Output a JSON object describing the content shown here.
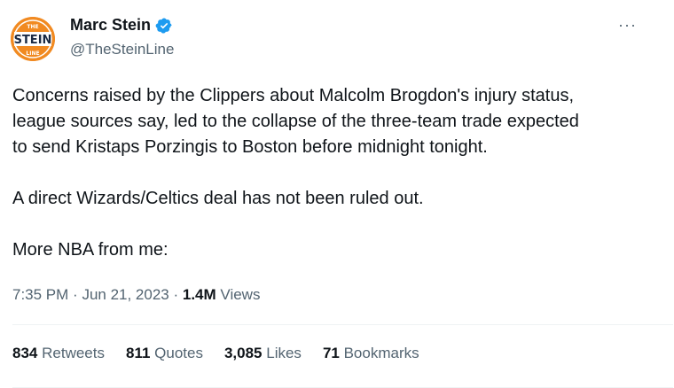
{
  "author": {
    "display_name": "Marc Stein",
    "handle": "@TheSteinLine",
    "avatar_text_top": "THE",
    "avatar_text_main": "STEIN",
    "avatar_text_bottom": "LINE",
    "verified_icon": "verified-badge-icon",
    "verified_color": "#1d9bf0",
    "avatar_color": "#f18a21"
  },
  "more_label": "···",
  "body": {
    "p1_line1": "Concerns raised by the Clippers about Malcolm Brogdon's injury status,",
    "p1_line2": "league sources say, led to the collapse of the three-team trade expected",
    "p1_line3": "to send Kristaps Porzingis to Boston before midnight tonight.",
    "p2": "A direct Wizards/Celtics deal has not been ruled out.",
    "p3": "More NBA from me:"
  },
  "meta": {
    "time": "7:35 PM",
    "date": "Jun 21, 2023",
    "views_count": "1.4M",
    "views_label": "Views"
  },
  "stats": [
    {
      "num": "834",
      "label": "Retweets"
    },
    {
      "num": "811",
      "label": "Quotes"
    },
    {
      "num": "3,085",
      "label": "Likes"
    },
    {
      "num": "71",
      "label": "Bookmarks"
    }
  ]
}
